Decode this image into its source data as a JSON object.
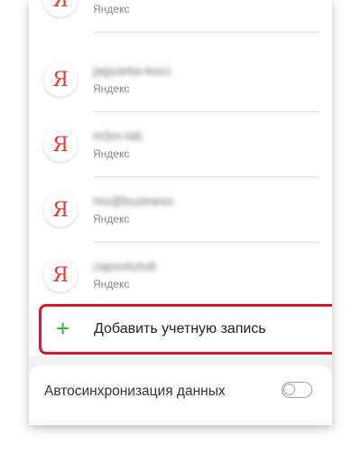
{
  "accounts": [
    {
      "name": "",
      "type": "Яндекс",
      "icon": "yandex-icon",
      "icon_glyph": "Я"
    },
    {
      "name": "jaguarka-kocc",
      "type": "Яндекс",
      "icon": "yandex-icon",
      "icon_glyph": "Я"
    },
    {
      "name": "m3m-lab",
      "type": "Яндекс",
      "icon": "yandex-icon",
      "icon_glyph": "Я"
    },
    {
      "name": "mo@business",
      "type": "Яндекс",
      "icon": "yandex-icon",
      "icon_glyph": "Я"
    },
    {
      "name": "zapovkzlub",
      "type": "Яндекс",
      "icon": "yandex-icon",
      "icon_glyph": "Я"
    }
  ],
  "add_account": {
    "label": "Добавить учетную запись",
    "icon": "plus-icon",
    "glyph": "+"
  },
  "autosync": {
    "label": "Автосинхронизация данных",
    "enabled": false
  },
  "colors": {
    "yandex_red": "#e53935",
    "plus_green": "#2fb344",
    "highlight_red": "#d51b2b"
  }
}
